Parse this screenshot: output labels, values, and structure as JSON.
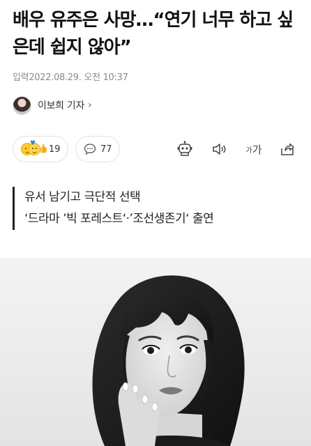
{
  "article": {
    "headline": "배우 유주은 사망…“연기 너무 하고 싶은데 쉽지 않아”",
    "dateline": "입력2022.08.29. 오전 10:37",
    "reporter": {
      "name": "이보희 기자",
      "chevron": "›"
    },
    "reactions": {
      "count": "19",
      "icon": "emoji-reaction-icon"
    },
    "comments": {
      "count": "77",
      "icon": "speech-bubble-icon"
    },
    "toolbar": {
      "robot_icon": "robot-icon",
      "speaker_icon": "speaker-icon",
      "font_small": "가",
      "font_big": "가",
      "share_icon": "share-icon"
    },
    "summary": [
      "유서 남기고 극단적 선택",
      "‘드라마 ’빅 포레스트‘·’조선생존기‘ 출연"
    ],
    "photo": {
      "style": "black-and-white portrait"
    }
  },
  "colors": {
    "text": "#111111",
    "muted": "#8a8a8a",
    "border": "#e2e2e2",
    "emoji": "#ffcc33",
    "summary_rule": "#222222"
  }
}
